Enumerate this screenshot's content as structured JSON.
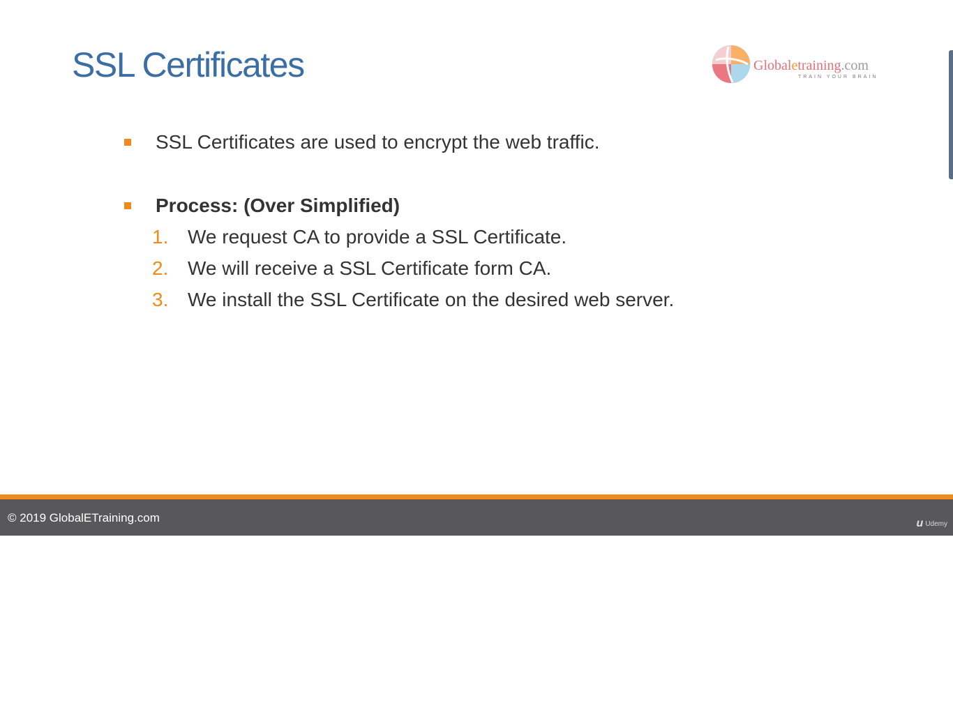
{
  "slide": {
    "title": "SSL Certificates",
    "logo": {
      "name_parts": [
        "Global",
        "e",
        "training",
        ".com"
      ],
      "tagline": "TRAIN YOUR BRAIN"
    },
    "bullets": [
      {
        "text": "SSL Certificates are used to encrypt the web traffic.",
        "bold": false
      },
      {
        "text": "Process: (Over Simplified)",
        "bold": true
      }
    ],
    "steps": [
      {
        "number": "1.",
        "text": "We request CA to provide a SSL Certificate."
      },
      {
        "number": "2.",
        "text": "We will receive a SSL Certificate form CA."
      },
      {
        "number": "3.",
        "text": "We install the SSL Certificate on the desired web server."
      }
    ]
  },
  "footer": {
    "copyright": "© 2019 GlobalETraining.com",
    "udemy_label": "Udemy",
    "udemy_icon": "udemy-logo-icon"
  },
  "colors": {
    "title": "#3a6ea5",
    "accent": "#f08a1c",
    "footer_bg": "#58585a",
    "body_text": "#333333"
  }
}
